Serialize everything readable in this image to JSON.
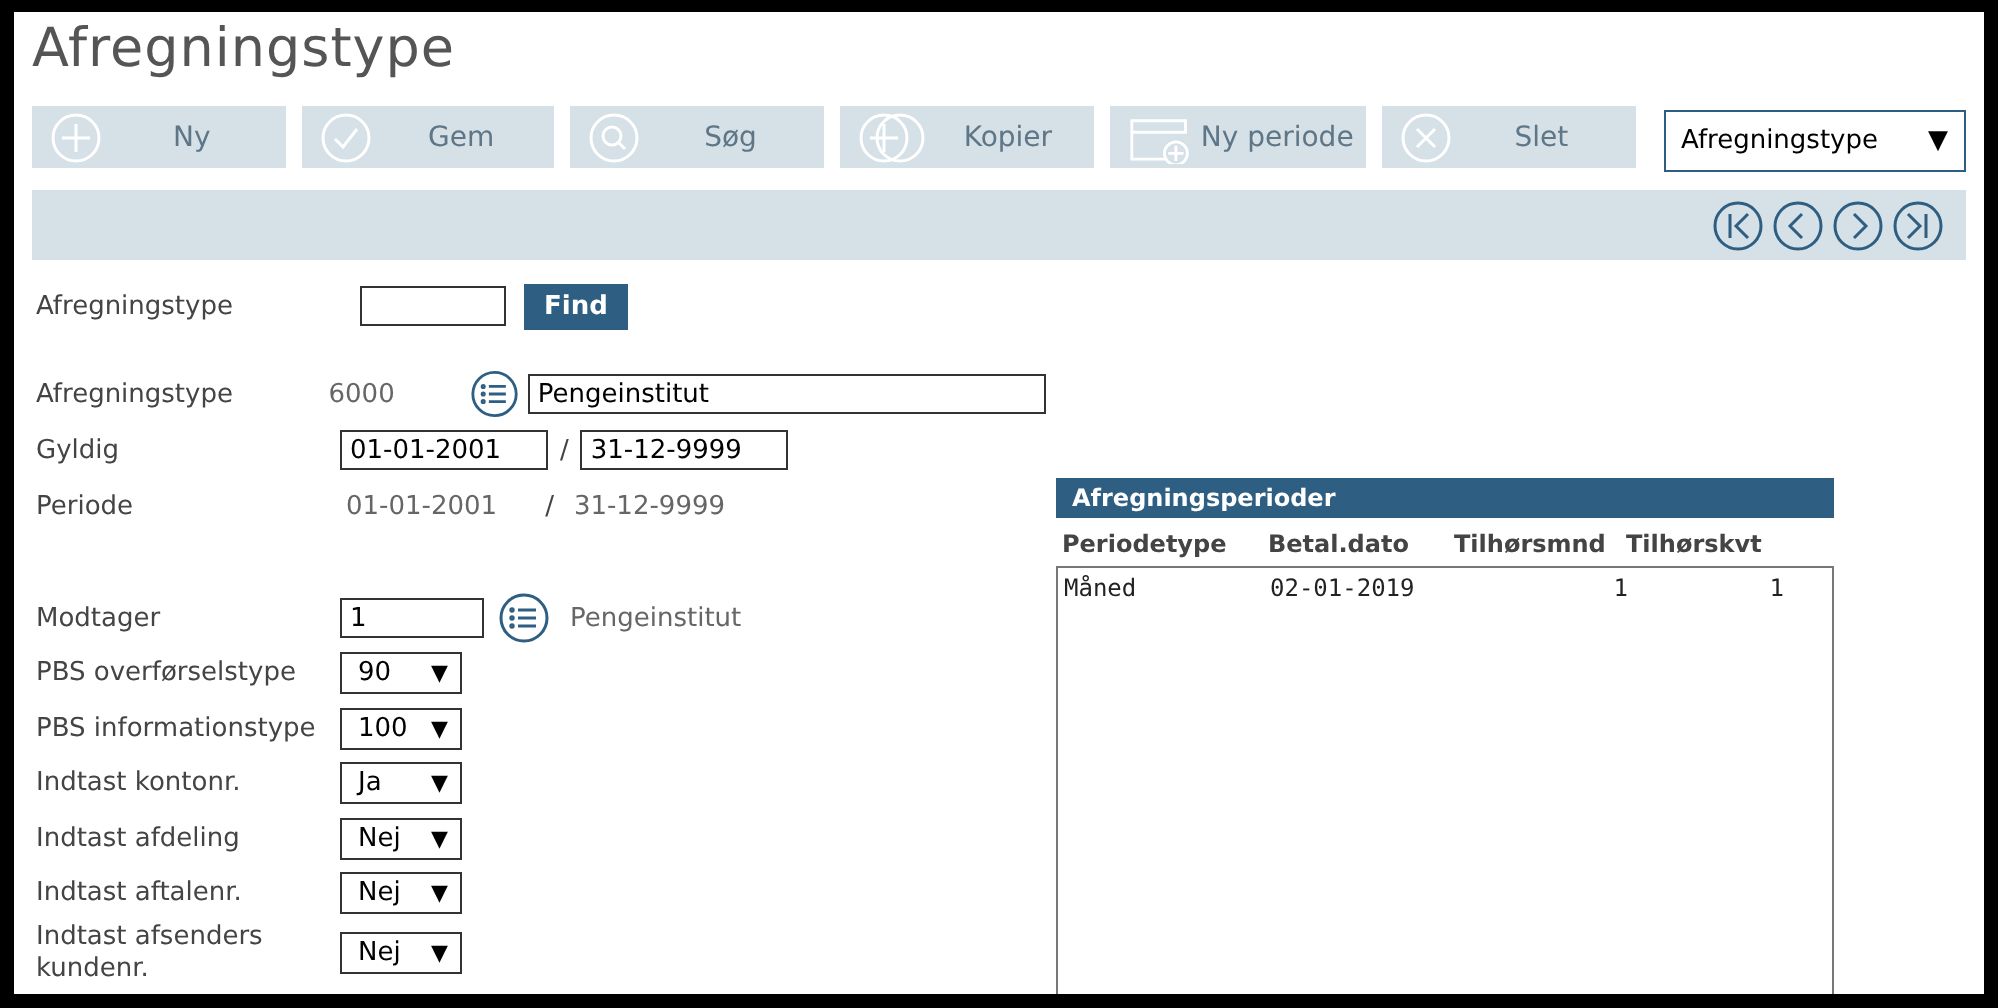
{
  "title": "Afregningstype",
  "toolbar": [
    {
      "kind": "plus",
      "label": "Ny",
      "disabled": true
    },
    {
      "kind": "check",
      "label": "Gem",
      "disabled": true
    },
    {
      "kind": "search",
      "label": "Søg",
      "disabled": true
    },
    {
      "kind": "copy",
      "label": "Kopier",
      "disabled": true
    },
    {
      "kind": "calendar",
      "label": "Ny periode",
      "disabled": true
    },
    {
      "kind": "cross",
      "label": "Slet",
      "disabled": true
    }
  ],
  "view_select": {
    "value": "Afregningstype",
    "arrow": "▼"
  },
  "nav": [
    {
      "kind": "first"
    },
    {
      "kind": "prev"
    },
    {
      "kind": "next"
    },
    {
      "kind": "last"
    }
  ],
  "search": {
    "label": "Afregningstype",
    "button": "Find"
  },
  "record": {
    "type_label": "Afregningstype",
    "type_code": "6000",
    "type_name": "Pengeinstitut",
    "valid_label": "Gyldig",
    "valid_from": "01-01-2001",
    "valid_sep": "/",
    "valid_to": "31-12-9999",
    "period_label": "Periode",
    "period_from": "01-01-2001",
    "period_sep": "/",
    "period_to": "31-12-9999",
    "recipient_label": "Modtager",
    "recipient_value": "1",
    "recipient_name": "Pengeinstitut"
  },
  "selects": [
    {
      "label": "PBS overførselstype",
      "value": "90",
      "arrow": "▼"
    },
    {
      "label": "PBS informationstype",
      "value": "100",
      "arrow": "▼"
    },
    {
      "label": "Indtast kontonr.",
      "value": "Ja",
      "arrow": "▼"
    },
    {
      "label": "Indtast afdeling",
      "value": "Nej",
      "arrow": "▼"
    },
    {
      "label": "Indtast aftalenr.",
      "value": "Nej",
      "arrow": "▼"
    },
    {
      "label": "Indtast afsenders kundenr.",
      "value": "Nej",
      "arrow": "▼"
    }
  ],
  "periods": {
    "title": "Afregningsperioder",
    "columns": [
      "Periodetype",
      "Betal.dato",
      "Tilhørsmnd",
      "Tilhørskvt"
    ],
    "rows": [
      [
        "Måned",
        "02-01-2019",
        "1",
        "1"
      ]
    ]
  }
}
